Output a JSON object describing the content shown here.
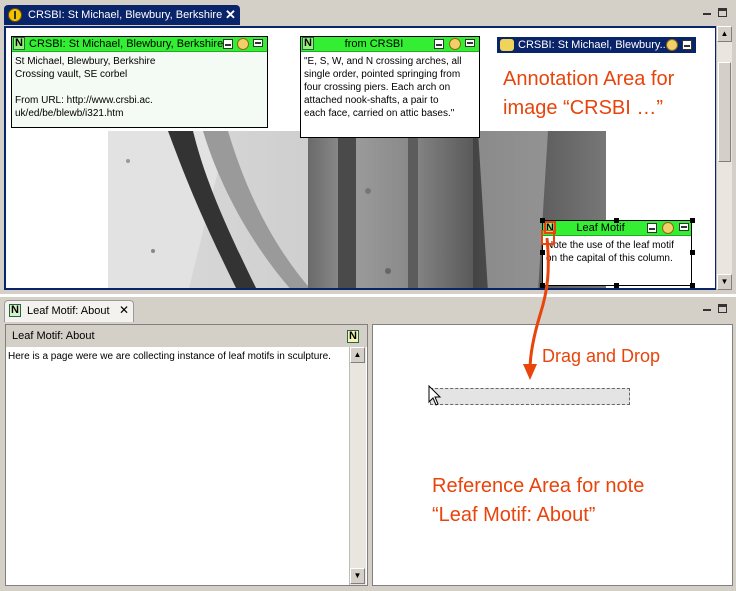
{
  "top_view": {
    "tab_title": "CRSBI: St Michael, Blewbury, Berkshire",
    "tab_close": "✕"
  },
  "notes": {
    "crsbi": {
      "title": "CRSBI: St Michael, Blewbury, Berkshire",
      "badge": "N",
      "body": "St Michael, Blewbury, Berkshire\nCrossing vault, SE corbel\n\nFrom URL: http://www.crsbi.ac.\nuk/ed/be/blewb/i321.htm"
    },
    "from_crsbi": {
      "title": "from CRSBI",
      "badge": "N",
      "body": "\"E, S, W, and N crossing arches, all\nsingle order, pointed springing from\nfour crossing piers. Each arch on\nattached nook-shafts, a pair to\neach face, carried on attic bases.\""
    },
    "collapsed": {
      "title": "CRSBI: St Michael, Blewbury..."
    },
    "leaf_motif": {
      "title": "Leaf Motif",
      "badge": "N",
      "body": "Note the use of the leaf motif\non the capital of this column."
    }
  },
  "callouts": {
    "annotation_line1": "Annotation Area for",
    "annotation_line2": "image “CRSBI …”",
    "drag_drop": "Drag and Drop",
    "reference_line1": "Reference Area for note",
    "reference_line2": "“Leaf Motif: About”"
  },
  "bottom_view": {
    "tab_title": "Leaf Motif: About",
    "tab_badge": "N",
    "tab_close": "✕",
    "pane_title": "Leaf Motif: About",
    "pane_badge": "N",
    "pane_text": "Here is a page were we are collecting instance of leaf motifs in sculpture."
  },
  "scroll": {
    "up": "▲",
    "down": "▼"
  },
  "colors": {
    "note_header": "#33ee33",
    "selection_blue": "#0a246a",
    "callout": "#e8440c"
  }
}
